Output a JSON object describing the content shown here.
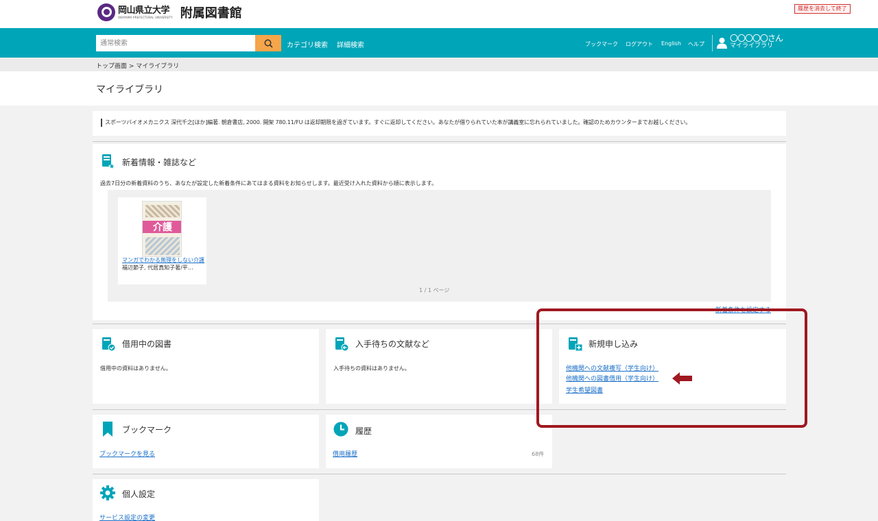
{
  "header": {
    "univ_name": "岡山県立大学",
    "univ_sub": "OKAYAMA PREFECTURAL UNIVERSITY",
    "library_name": "附属図書館",
    "exit_label": "履歴を消去して終了"
  },
  "nav": {
    "search_placeholder": "通常検索",
    "category_search": "カテゴリ検索",
    "advanced_search": "詳細検索",
    "bookmark": "ブックマーク",
    "logout": "ログアウト",
    "english": "English",
    "help": "ヘルプ",
    "user_name": "〇〇〇〇〇さん",
    "mylibrary": "マイライブラリ"
  },
  "breadcrumb": "トップ画面 > マイライブラリ",
  "page_title": "マイライブラリ",
  "notice": "スポーツバイオメカニクス 深代千之[ほか]編著. 朝倉書店, 2000. 開架 780.11/FU は返却期限を過ぎています。すぐに返却してください。あなたが借りられていた本が講義室に忘れられていました。確認のためカウンターまでお越しください。",
  "arrivals": {
    "title": "新着情報・雑誌など",
    "description": "過去7日分の新着資料のうち、あなたが設定した新着条件にあてはまる資料をお知らせします。最近受け入れた資料から順に表示します。",
    "cover_text": "介護",
    "book_title": "マンガでわかる無理をしない介護",
    "book_author": "福辺節子, 代居真知子著/平…",
    "pager": "1 / 1 ページ",
    "settings_link": "新着条件を設定する"
  },
  "loans": {
    "title": "借用中の図書",
    "empty": "借用中の資料はありません。"
  },
  "waiting": {
    "title": "入手待ちの文献など",
    "empty": "入手待ちの資料はありません。"
  },
  "requests": {
    "title": "新規申し込み",
    "links": [
      "他機関への文献複写（学生向け）",
      "他機関への図書借用（学生向け）",
      "学生希望図書"
    ]
  },
  "bookmarks": {
    "title": "ブックマーク",
    "link": "ブックマークを見る"
  },
  "history": {
    "title": "履歴",
    "link": "借用履歴",
    "count": "68件"
  },
  "settings": {
    "title": "個人設定",
    "link": "サービス設定の変更"
  },
  "colors": {
    "teal": "#00a5b8",
    "search_button": "#f5a54a",
    "highlight": "#a01820",
    "link": "#1a6fc7"
  }
}
